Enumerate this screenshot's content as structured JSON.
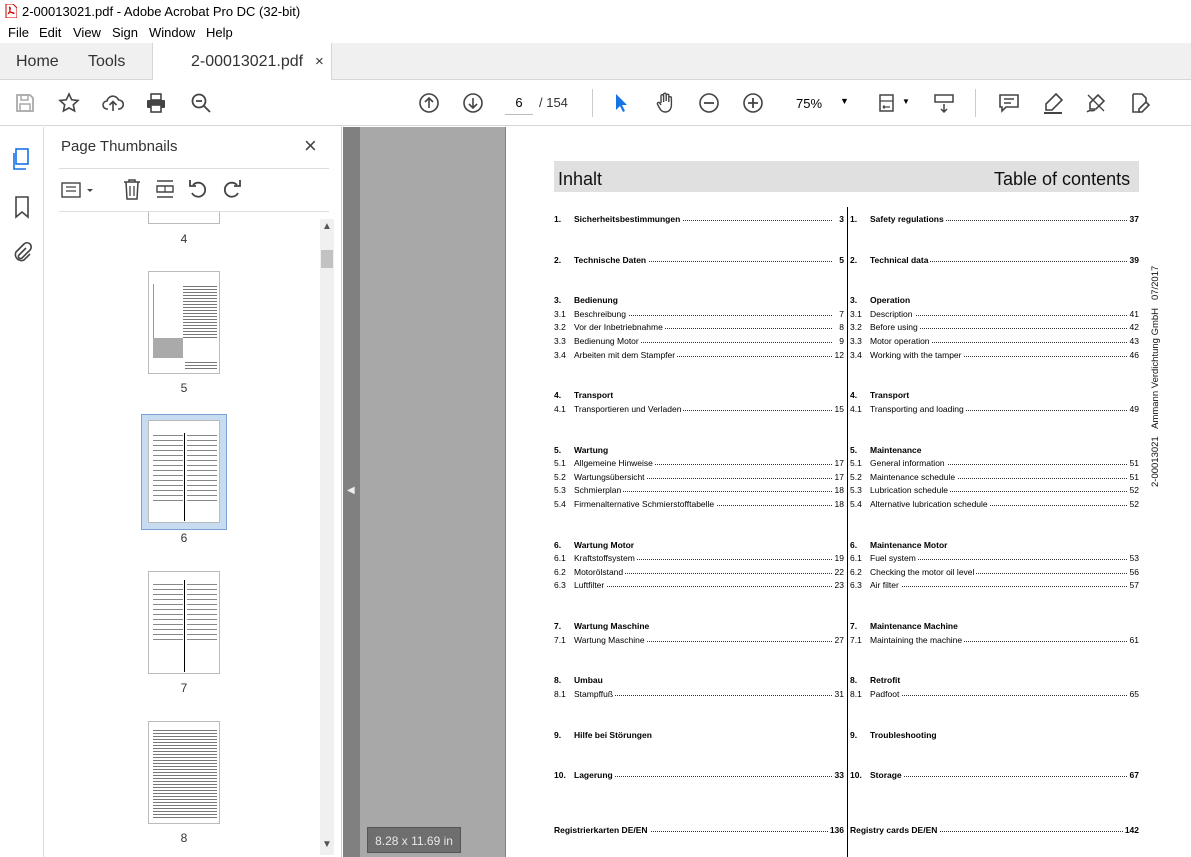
{
  "window": {
    "title": "2-00013021.pdf - Adobe Acrobat Pro DC (32-bit)"
  },
  "menu": [
    "File",
    "Edit",
    "View",
    "Sign",
    "Window",
    "Help"
  ],
  "tabs": {
    "home": "Home",
    "tools": "Tools",
    "document": "2-00013021.pdf"
  },
  "toolbar": {
    "page_current": "6",
    "page_total": "/ 154",
    "zoom": "75%"
  },
  "thumbnails": {
    "panel_title": "Page Thumbnails",
    "pages": [
      "4",
      "5",
      "6",
      "7",
      "8"
    ],
    "selected": "6"
  },
  "page_size": "8.28 x 11.69 in",
  "document": {
    "header_left": "Inhalt",
    "header_right": "Table of contents",
    "side_text": "2-00013021   Ammann Verdichtung GmbH   07/2017",
    "left": [
      {
        "num": "1.",
        "label": "Sicherheitsbestimmungen",
        "page": "3",
        "bold": true
      },
      {
        "num": "2.",
        "label": "Technische Daten",
        "page": "5",
        "bold": true
      },
      {
        "num": "3.",
        "label": "Bedienung",
        "page": "",
        "bold": true
      },
      {
        "num": "3.1",
        "label": "Beschreibung",
        "page": "7",
        "bold": false
      },
      {
        "num": "3.2",
        "label": "Vor der Inbetriebnahme",
        "page": "8",
        "bold": false
      },
      {
        "num": "3.3",
        "label": "Bedienung Motor",
        "page": "9",
        "bold": false
      },
      {
        "num": "3.4",
        "label": "Arbeiten mit dem Stampfer",
        "page": "12",
        "bold": false
      },
      {
        "num": "4.",
        "label": "Transport",
        "page": "",
        "bold": true
      },
      {
        "num": "4.1",
        "label": "Transportieren und Verladen",
        "page": "15",
        "bold": false
      },
      {
        "num": "5.",
        "label": "Wartung",
        "page": "",
        "bold": true
      },
      {
        "num": "5.1",
        "label": "Allgemeine Hinweise",
        "page": "17",
        "bold": false
      },
      {
        "num": "5.2",
        "label": "Wartungsübersicht",
        "page": "17",
        "bold": false
      },
      {
        "num": "5.3",
        "label": "Schmierplan",
        "page": "18",
        "bold": false
      },
      {
        "num": "5.4",
        "label": "Firmenalternative Schmierstofftabelle",
        "page": "18",
        "bold": false
      },
      {
        "num": "6.",
        "label": "Wartung Motor",
        "page": "",
        "bold": true
      },
      {
        "num": "6.1",
        "label": "Kraftstoffsystem",
        "page": "19",
        "bold": false
      },
      {
        "num": "6.2",
        "label": "Motorölstand",
        "page": "22",
        "bold": false
      },
      {
        "num": "6.3",
        "label": "Luftfilter",
        "page": "23",
        "bold": false
      },
      {
        "num": "7.",
        "label": "Wartung Maschine",
        "page": "",
        "bold": true
      },
      {
        "num": "7.1",
        "label": "Wartung Maschine",
        "page": "27",
        "bold": false
      },
      {
        "num": "8.",
        "label": "Umbau",
        "page": "",
        "bold": true
      },
      {
        "num": "8.1",
        "label": "Stampffuß",
        "page": "31",
        "bold": false
      },
      {
        "num": "9.",
        "label": "Hilfe bei Störungen",
        "page": "",
        "bold": true
      },
      {
        "num": "10.",
        "label": "Lagerung",
        "page": "33",
        "bold": true
      },
      {
        "num": "",
        "label": "Registrierkarten DE/EN",
        "page": "136",
        "bold": true
      }
    ],
    "right": [
      {
        "num": "1.",
        "label": "Safety regulations",
        "page": "37",
        "bold": true
      },
      {
        "num": "2.",
        "label": "Technical data",
        "page": "39",
        "bold": true
      },
      {
        "num": "3.",
        "label": "Operation",
        "page": "",
        "bold": true
      },
      {
        "num": "3.1",
        "label": "Description",
        "page": "41",
        "bold": false
      },
      {
        "num": "3.2",
        "label": "Before using",
        "page": "42",
        "bold": false
      },
      {
        "num": "3.3",
        "label": "Motor operation",
        "page": "43",
        "bold": false
      },
      {
        "num": "3.4",
        "label": "Working with the tamper",
        "page": "46",
        "bold": false
      },
      {
        "num": "4.",
        "label": "Transport",
        "page": "",
        "bold": true
      },
      {
        "num": "4.1",
        "label": "Transporting and loading",
        "page": "49",
        "bold": false
      },
      {
        "num": "5.",
        "label": "Maintenance",
        "page": "",
        "bold": true
      },
      {
        "num": "5.1",
        "label": "General information",
        "page": "51",
        "bold": false
      },
      {
        "num": "5.2",
        "label": "Maintenance schedule",
        "page": "51",
        "bold": false
      },
      {
        "num": "5.3",
        "label": "Lubrication schedule",
        "page": "52",
        "bold": false
      },
      {
        "num": "5.4",
        "label": "Alternative lubrication schedule",
        "page": "52",
        "bold": false
      },
      {
        "num": "6.",
        "label": "Maintenance Motor",
        "page": "",
        "bold": true
      },
      {
        "num": "6.1",
        "label": "Fuel system",
        "page": "53",
        "bold": false
      },
      {
        "num": "6.2",
        "label": "Checking the motor oil level",
        "page": "56",
        "bold": false
      },
      {
        "num": "6.3",
        "label": "Air filter",
        "page": "57",
        "bold": false
      },
      {
        "num": "7.",
        "label": "Maintenance Machine",
        "page": "",
        "bold": true
      },
      {
        "num": "7.1",
        "label": "Maintaining the machine",
        "page": "61",
        "bold": false
      },
      {
        "num": "8.",
        "label": "Retrofit",
        "page": "",
        "bold": true
      },
      {
        "num": "8.1",
        "label": "Padfoot",
        "page": "65",
        "bold": false
      },
      {
        "num": "9.",
        "label": "Troubleshooting",
        "page": "",
        "bold": true
      },
      {
        "num": "10.",
        "label": "Storage",
        "page": "67",
        "bold": true
      },
      {
        "num": "",
        "label": "Registry cards DE/EN",
        "page": "142",
        "bold": true
      }
    ]
  }
}
